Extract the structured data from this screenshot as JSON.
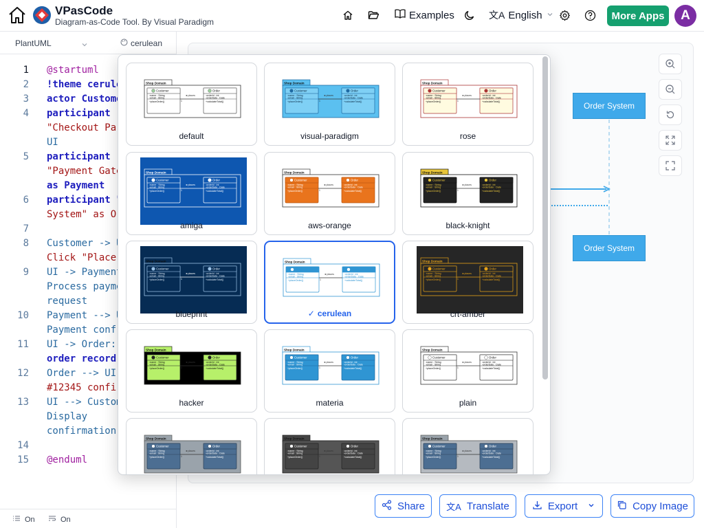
{
  "header": {
    "title": "VPasCode",
    "subtitle": "Diagram-as-Code Tool. By Visual Paradigm",
    "examples_label": "Examples",
    "language_label": "English",
    "more_apps_label": "More Apps",
    "avatar_initial": "A",
    "accent_color": "#15a06f"
  },
  "editor": {
    "language": "PlantUML",
    "theme": "cerulean",
    "line_numbers": [
      "1",
      "2",
      "3",
      "4",
      "",
      "5",
      "",
      "",
      "6",
      "",
      "7",
      "8",
      "",
      "9",
      "",
      "",
      "10",
      "",
      "11",
      "",
      "12",
      "",
      "13",
      "",
      "",
      "14",
      "15"
    ],
    "wrap_status": "On",
    "minimap_status": "On"
  },
  "code_lines": [
    "@startuml",
    "!theme cerulean",
    "actor Customer",
    "participant",
    "\"Checkout Pa",
    "UI",
    "participant",
    "\"Payment Gate",
    "as Payment",
    "participant \"",
    "System\" as O",
    "",
    "Customer -> U",
    "Click \"Place",
    "UI -> Payment",
    "Process payme",
    "request",
    "Payment --> U",
    "Payment conf",
    "UI -> Order:",
    "order record",
    "Order --> UI",
    "#12345 confi",
    "UI --> Custom",
    "Display",
    "confirmation",
    "",
    "@enduml"
  ],
  "diagram": {
    "nodes": [
      "Order System",
      "Order System"
    ],
    "node_color": "#3fa9ea"
  },
  "theme_picker": {
    "selected": "cerulean",
    "check_mark": "✓",
    "themes": [
      {
        "name": "default"
      },
      {
        "name": "visual-paradigm"
      },
      {
        "name": "rose"
      },
      {
        "name": "amiga"
      },
      {
        "name": "aws-orange"
      },
      {
        "name": "black-knight"
      },
      {
        "name": "blueprint"
      },
      {
        "name": "cerulean"
      },
      {
        "name": "crt-amber"
      },
      {
        "name": "hacker"
      },
      {
        "name": "materia"
      },
      {
        "name": "plain"
      },
      {
        "name": ""
      },
      {
        "name": ""
      },
      {
        "name": ""
      }
    ],
    "thumb_text": {
      "package": "Shop Domain",
      "class1": "Customer",
      "class2": "Order",
      "attr1": "name : String",
      "attr2": "email : String",
      "attr3": "orderId : int",
      "attr4": "orderDate : Date",
      "op1": "placeOrder()",
      "op2": "calculateTotal()",
      "rel": "places",
      "mult": "1"
    }
  },
  "actions": {
    "share": "Share",
    "translate": "Translate",
    "export": "Export",
    "copy_image": "Copy Image"
  }
}
